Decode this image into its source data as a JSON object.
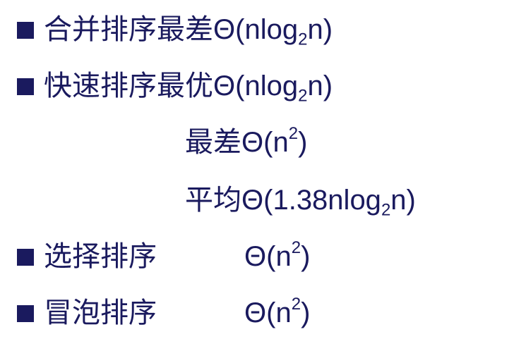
{
  "items": [
    {
      "label": "合并排序最差",
      "theta": "Θ",
      "open": "(",
      "pre": "nlog",
      "sub": "2",
      "post": "n",
      "close": ")"
    },
    {
      "label": "快速排序最优",
      "theta": "Θ",
      "open": "(",
      "pre": "nlog",
      "sub": "2",
      "post": "n",
      "close": ")"
    },
    {
      "label": "最差",
      "theta": "Θ",
      "open": "(",
      "pre": "n",
      "sup": "2",
      "close": ")"
    },
    {
      "label": "平均",
      "theta": "Θ",
      "open": "(",
      "pre": "1.38nlog",
      "sub": "2",
      "post": "n",
      "close": ")"
    },
    {
      "label": "选择排序",
      "theta": "Θ",
      "open": "(",
      "pre": "n",
      "sup": "2",
      "close": ")"
    },
    {
      "label": "冒泡排序",
      "theta": "Θ",
      "open": "(",
      "pre": "n",
      "sup": "2",
      "close": ")"
    }
  ],
  "colors": {
    "text": "#1a1a5e",
    "bullet": "#1a1a5e",
    "background": "#ffffff"
  },
  "icons": {
    "bullet": "square-bullet-icon"
  }
}
